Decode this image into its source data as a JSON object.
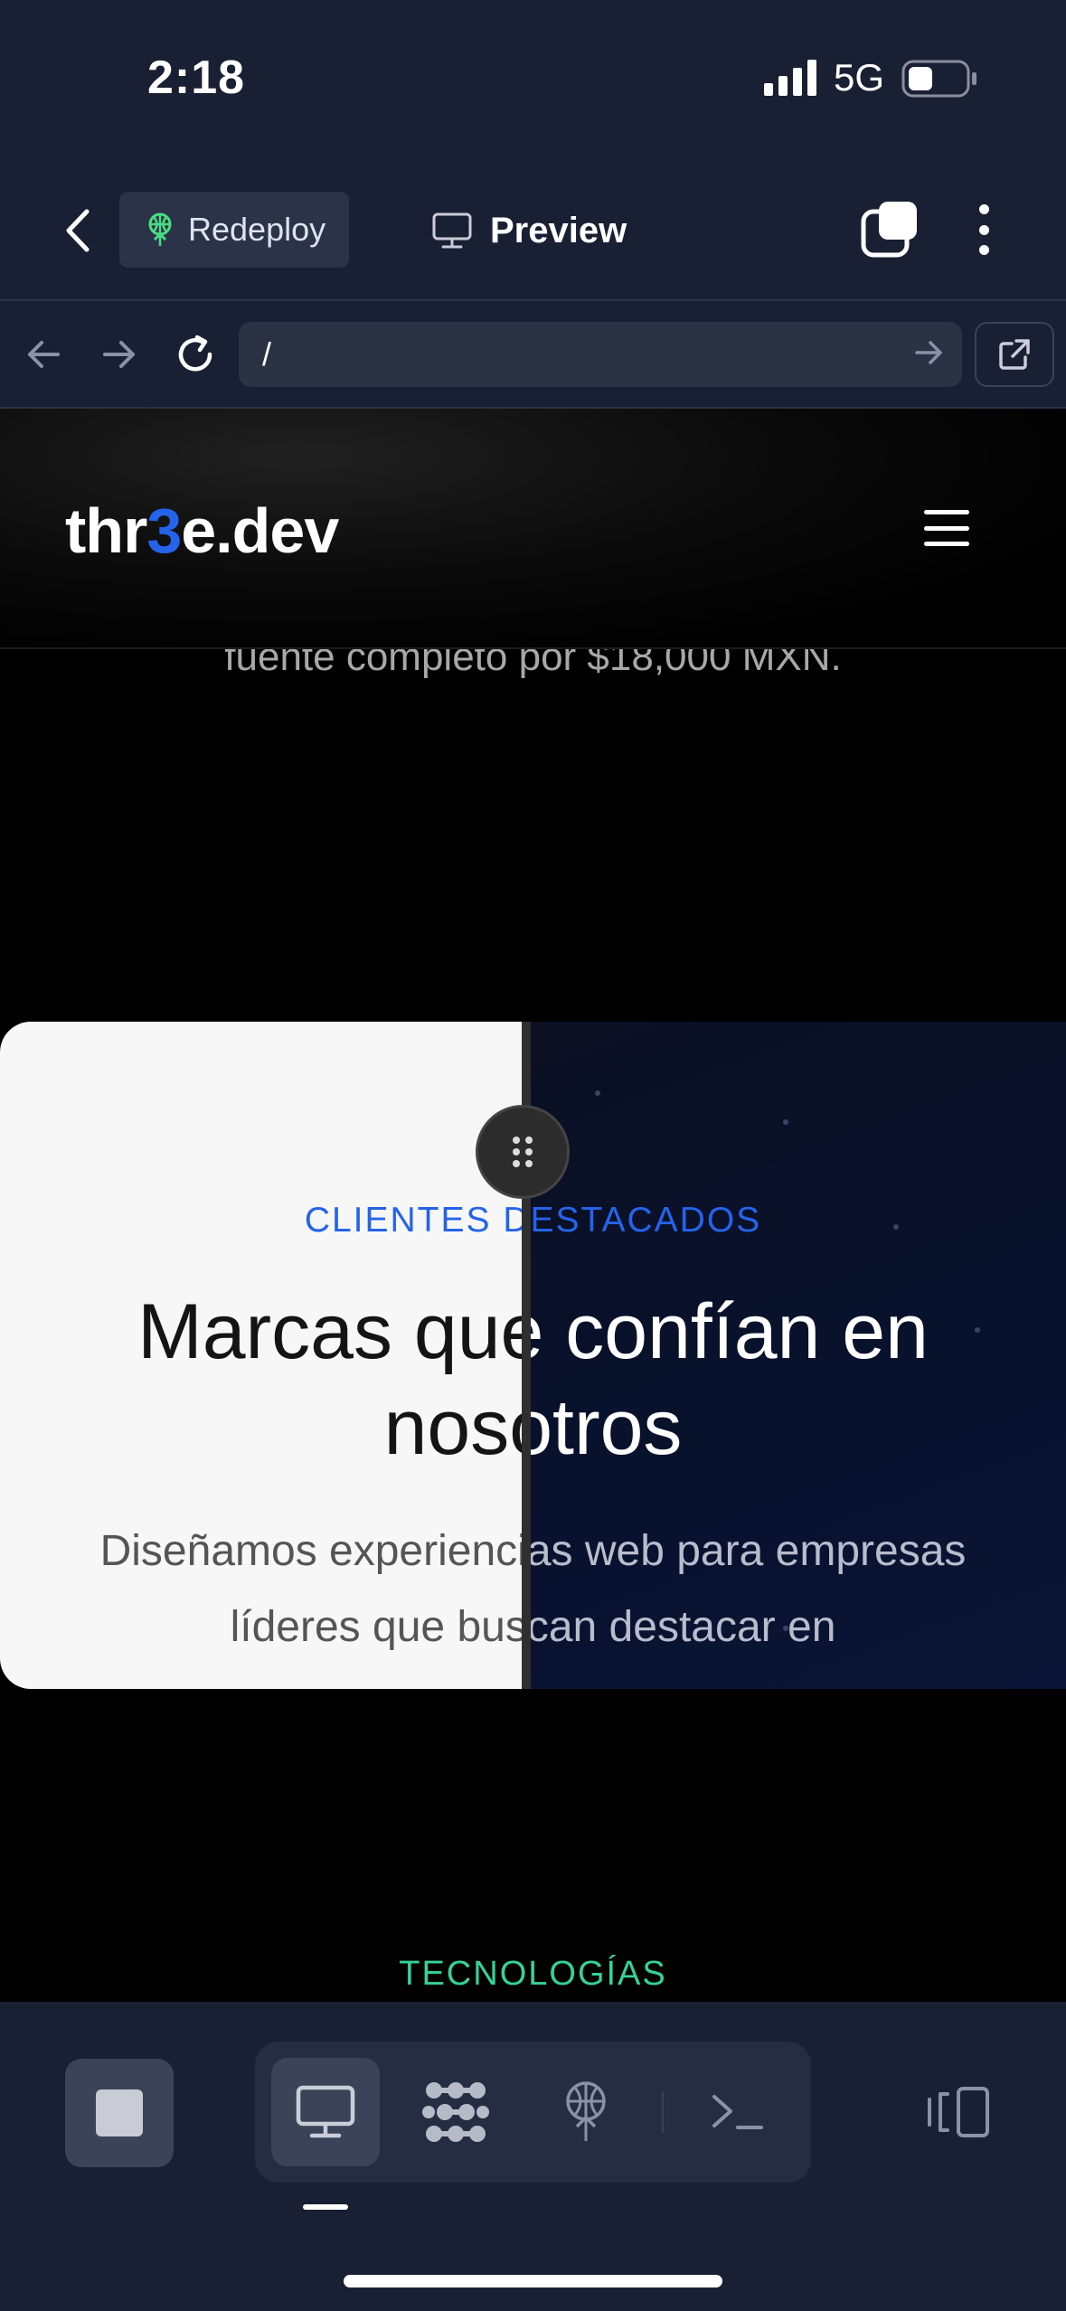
{
  "status_bar": {
    "time": "2:18",
    "network": "5G"
  },
  "header": {
    "redeploy_label": "Redeploy",
    "preview_label": "Preview"
  },
  "browser": {
    "url": "/"
  },
  "site": {
    "logo_prefix": "thr",
    "logo_accent": "3",
    "logo_suffix": "e.dev",
    "accent_color": "#2563eb",
    "hero_tail": "fuente completo por $18,000 MXN.",
    "clients": {
      "eyebrow": "CLIENTES DESTACADOS",
      "heading": "Marcas que confían en nosotros",
      "subtitle": "Diseñamos experiencias web para empresas líderes que buscan destacar en"
    },
    "tech_label": "TECNOLOGÍAS"
  },
  "toolbar": {
    "buttons": [
      "stop-icon",
      "monitor-icon",
      "graph-icon",
      "deploy-icon",
      "terminal-icon",
      "layout-icon"
    ]
  }
}
